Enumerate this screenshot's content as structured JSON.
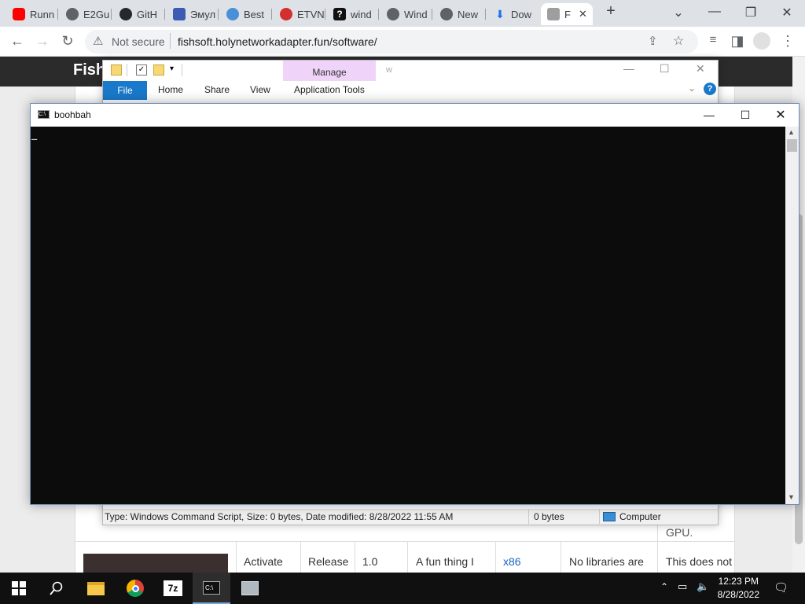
{
  "browser": {
    "tabs": [
      {
        "label": "Runn",
        "color": "#ff0000"
      },
      {
        "label": "E2Gu",
        "color": "#5f6368"
      },
      {
        "label": "GitH",
        "color": "#24292f"
      },
      {
        "label": "Эмул",
        "color": "#3b5bb5"
      },
      {
        "label": "Best",
        "color": "#4a90d9"
      },
      {
        "label": "ETVN",
        "color": "#d32f2f"
      },
      {
        "label": "wind",
        "color": "#111111"
      },
      {
        "label": "Wind",
        "color": "#5f6368"
      },
      {
        "label": "New",
        "color": "#5f6368"
      },
      {
        "label": "Dow",
        "color": "#1a73e8"
      },
      {
        "label": "F",
        "color": "#9e9e9e"
      }
    ],
    "new_tab_symbol": "+",
    "security_label": "Not secure",
    "url": "fishsoft.holynetworkadapter.fun/software/"
  },
  "page": {
    "site_title": "Fish",
    "row_cells": {
      "name": "Activate",
      "status": "Release",
      "version": "1.0",
      "description": "A fun thing I",
      "arch": "x86",
      "libraries": "No libraries are",
      "notes": "This does not"
    },
    "above_note": "GPU."
  },
  "explorer": {
    "manage_label": "Manage",
    "title_partial": "w",
    "ribbon_tabs": [
      "File",
      "Home",
      "Share",
      "View",
      "Application Tools"
    ],
    "status_text": "Type: Windows Command Script, Size: 0 bytes, Date modified: 8/28/2022 11:55 AM",
    "status_size": "0 bytes",
    "status_location": "Computer"
  },
  "console": {
    "title": "boohbah",
    "cursor": "_"
  },
  "taskbar": {
    "time": "12:23 PM",
    "date": "8/28/2022",
    "apps": [
      "windows-start",
      "search",
      "file-explorer",
      "chrome",
      "7zip",
      "command-prompt",
      "image-viewer"
    ]
  },
  "colors": {
    "console_bg": "#0c0c0c",
    "chrome_tabbar": "#dee1e6",
    "ribbon_file_tab": "#1979ca",
    "manage_context": "#efd3f9",
    "taskbar": "#101010"
  }
}
